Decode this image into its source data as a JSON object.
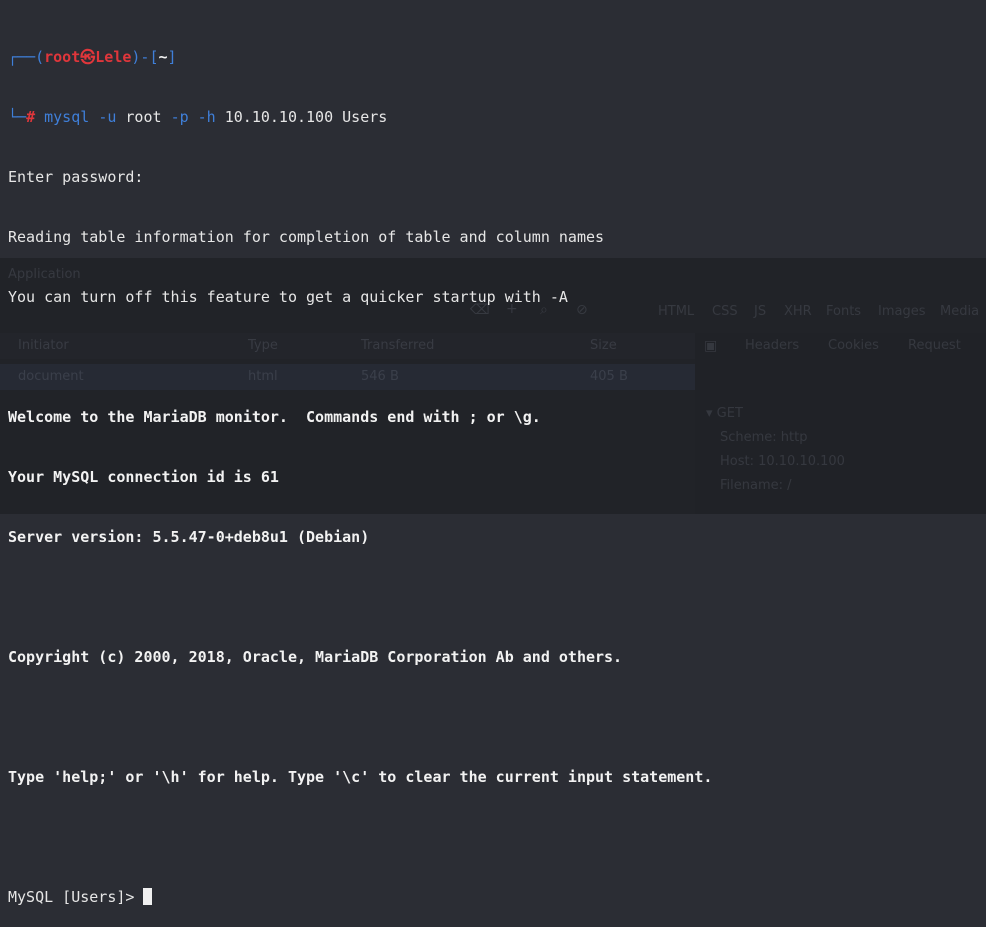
{
  "terminal": {
    "prompt": {
      "corner_top": "┌──(",
      "user": "root",
      "at_symbol": "㉿",
      "host": "Lele",
      "dir_open": ")-[",
      "cwd": "~",
      "dir_close": "]",
      "corner_bottom": "└─",
      "hash": "#"
    },
    "command": {
      "program": "mysql",
      "opt_user": "-u",
      "user_value": "root",
      "opt_password": "-p",
      "opt_host": "-h",
      "host_value": "10.10.10.100",
      "database": "Users"
    },
    "output": [
      "Enter password:",
      "Reading table information for completion of table and column names",
      "You can turn off this feature to get a quicker startup with -A",
      "",
      "Welcome to the MariaDB monitor.  Commands end with ; or \\g.",
      "Your MySQL connection id is 61",
      "Server version: 5.5.47-0+deb8u1 (Debian)",
      "",
      "Copyright (c) 2000, 2018, Oracle, MariaDB Corporation Ab and others.",
      "",
      "Type 'help;' or '\\h' for help. Type '\\c' to clear the current input statement.",
      ""
    ],
    "mysql_prompt": "MySQL [Users]>"
  },
  "background_devtools": {
    "tab": "Application",
    "columns": [
      "Initiator",
      "Type",
      "Transferred",
      "Size"
    ],
    "row": {
      "initiator": "document",
      "type": "html",
      "transferred": "546 B",
      "size": "405 B"
    },
    "side_tabs": [
      "Headers",
      "Cookies",
      "Request"
    ],
    "section": "GET",
    "details": [
      "Scheme: http",
      "Host: 10.10.10.100",
      "Filename: /"
    ],
    "filters": [
      "HTML",
      "CSS",
      "JS",
      "XHR",
      "Fonts",
      "Images",
      "Media"
    ]
  },
  "colors": {
    "prompt_blue": "#3f7fd9",
    "prompt_red": "#e0363b",
    "bg": "#2b2d34"
  }
}
